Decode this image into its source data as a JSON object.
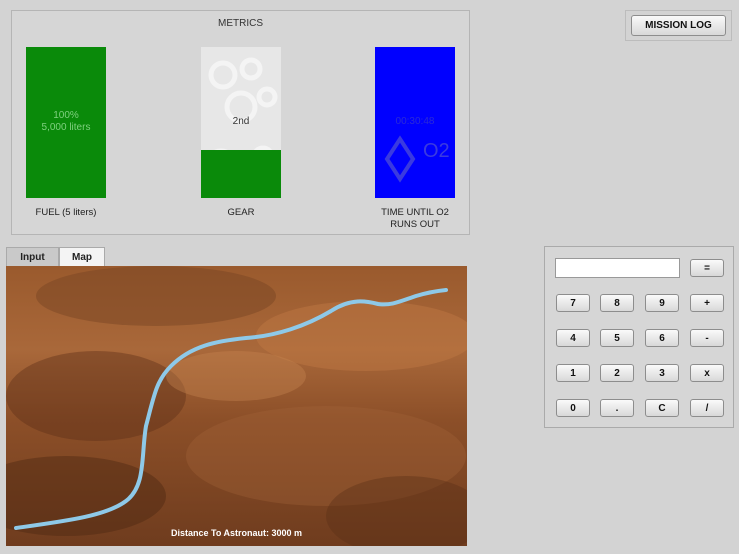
{
  "metrics": {
    "title": "METRICS",
    "fuel": {
      "line1": "100%",
      "line2": "5,000 liters",
      "caption": "FUEL (5 liters)",
      "level": 1.0,
      "color": "#0a8a0a"
    },
    "gear": {
      "value": "2nd",
      "caption": "GEAR",
      "level": 0.32,
      "color": "#0a8a0a"
    },
    "oxygen": {
      "time": "00:30:48",
      "symbol": "O2",
      "caption_line1": "TIME UNTIL O2",
      "caption_line2": "RUNS OUT",
      "level": 1.0,
      "color": "#0000ff"
    }
  },
  "mission_log_label": "MISSION LOG",
  "tabs": [
    {
      "label": "Input",
      "active": false
    },
    {
      "label": "Map",
      "active": true
    }
  ],
  "map": {
    "distance_text": "Distance To Astronaut: 3000 m"
  },
  "calculator": {
    "display_value": "",
    "equals_label": "=",
    "keys": [
      [
        "7",
        "8",
        "9",
        "+"
      ],
      [
        "4",
        "5",
        "6",
        "-"
      ],
      [
        "1",
        "2",
        "3",
        "x"
      ],
      [
        "0",
        ".",
        "C",
        "/"
      ]
    ]
  }
}
